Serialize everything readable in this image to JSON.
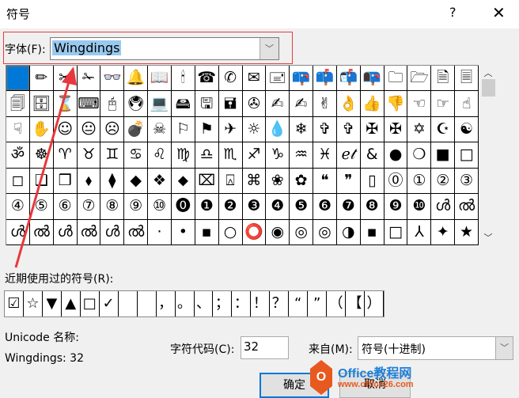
{
  "window": {
    "title": "符号",
    "help": "?",
    "close": "✕"
  },
  "font": {
    "label": "字体(F):",
    "value": "Wingdings",
    "arrow": "﹀"
  },
  "symbols": [
    " ",
    "✏",
    "✂",
    "✁",
    "👓",
    "🔔",
    "📖",
    "🕯",
    "☎",
    "✆",
    "✉",
    "🖃",
    "📪",
    "📫",
    "📬",
    "📭",
    "🗀",
    "🗁",
    "🗎",
    "🗏",
    "🗐",
    "🗄",
    "⌛",
    "⌨",
    "🖰",
    "🖲",
    "💻",
    "🖴",
    "🖫",
    "🖬",
    "✇",
    "✍",
    "✍",
    "✌",
    "👌",
    "👍",
    "👎",
    "☜",
    "☞",
    "☝",
    "☟",
    "✋",
    "☺",
    "😐",
    "☹",
    "💣",
    "☠",
    "⚐",
    "⚑",
    "✈",
    "☼",
    "💧",
    "❄",
    "✞",
    "✞",
    "✠",
    "✠",
    "✡",
    "☪",
    "☯",
    "ॐ",
    "☸",
    "♈",
    "♉",
    "♊",
    "♋",
    "♌",
    "♍",
    "♎",
    "♏",
    "♐",
    "♑",
    "♒",
    "♓",
    "ℯ𝓉",
    "&",
    "●",
    "❍",
    "■",
    "□",
    "◻",
    "❑",
    "❒",
    "⬧",
    "⧫",
    "◆",
    "❖",
    "⬥",
    "⌧",
    "⍓",
    "⌘",
    "❀",
    "✿",
    "❝",
    "❞",
    "▯",
    "⓪",
    "①",
    "②",
    "③",
    "④",
    "⑤",
    "⑥",
    "⑦",
    "⑧",
    "⑨",
    "⑩",
    "⓿",
    "❶",
    "❷",
    "❸",
    "❹",
    "❺",
    "❻",
    "❼",
    "❽",
    "❾",
    "❿",
    "ൾ",
    "ൽ",
    "ൾ",
    "ൽ",
    "ൾ",
    "ൽ",
    "ൾ",
    "ൽ",
    "·",
    "•",
    "▪",
    "○",
    "⭕",
    "◉",
    "◎",
    "◎",
    "◑",
    "▪",
    "□",
    "⅄",
    "✦",
    "★"
  ],
  "scroll": {
    "up": "︿",
    "down": "﹀"
  },
  "recent": {
    "label": "近期使用过的符号(R):",
    "items": [
      "☑",
      "☆",
      "▼",
      "▲",
      "□",
      "✓",
      " ",
      " ",
      "，",
      "。",
      "、",
      "；",
      "：",
      "！",
      "？",
      "“",
      "”",
      "（",
      "【",
      "）"
    ]
  },
  "unicode_name_label": "Unicode 名称:",
  "char_name": "Wingdings: 32",
  "char_code": {
    "label": "字符代码(C):",
    "value": "32"
  },
  "from": {
    "label": "来自(M):",
    "value": "符号(十进制)",
    "arrow": "﹀"
  },
  "buttons": {
    "ok": "确定",
    "cancel": "取消"
  },
  "watermark": {
    "name": "Office教程网",
    "url": "www.office26.com"
  },
  "colors": {
    "accent": "#0078d7",
    "annotation": "#e8383d"
  }
}
